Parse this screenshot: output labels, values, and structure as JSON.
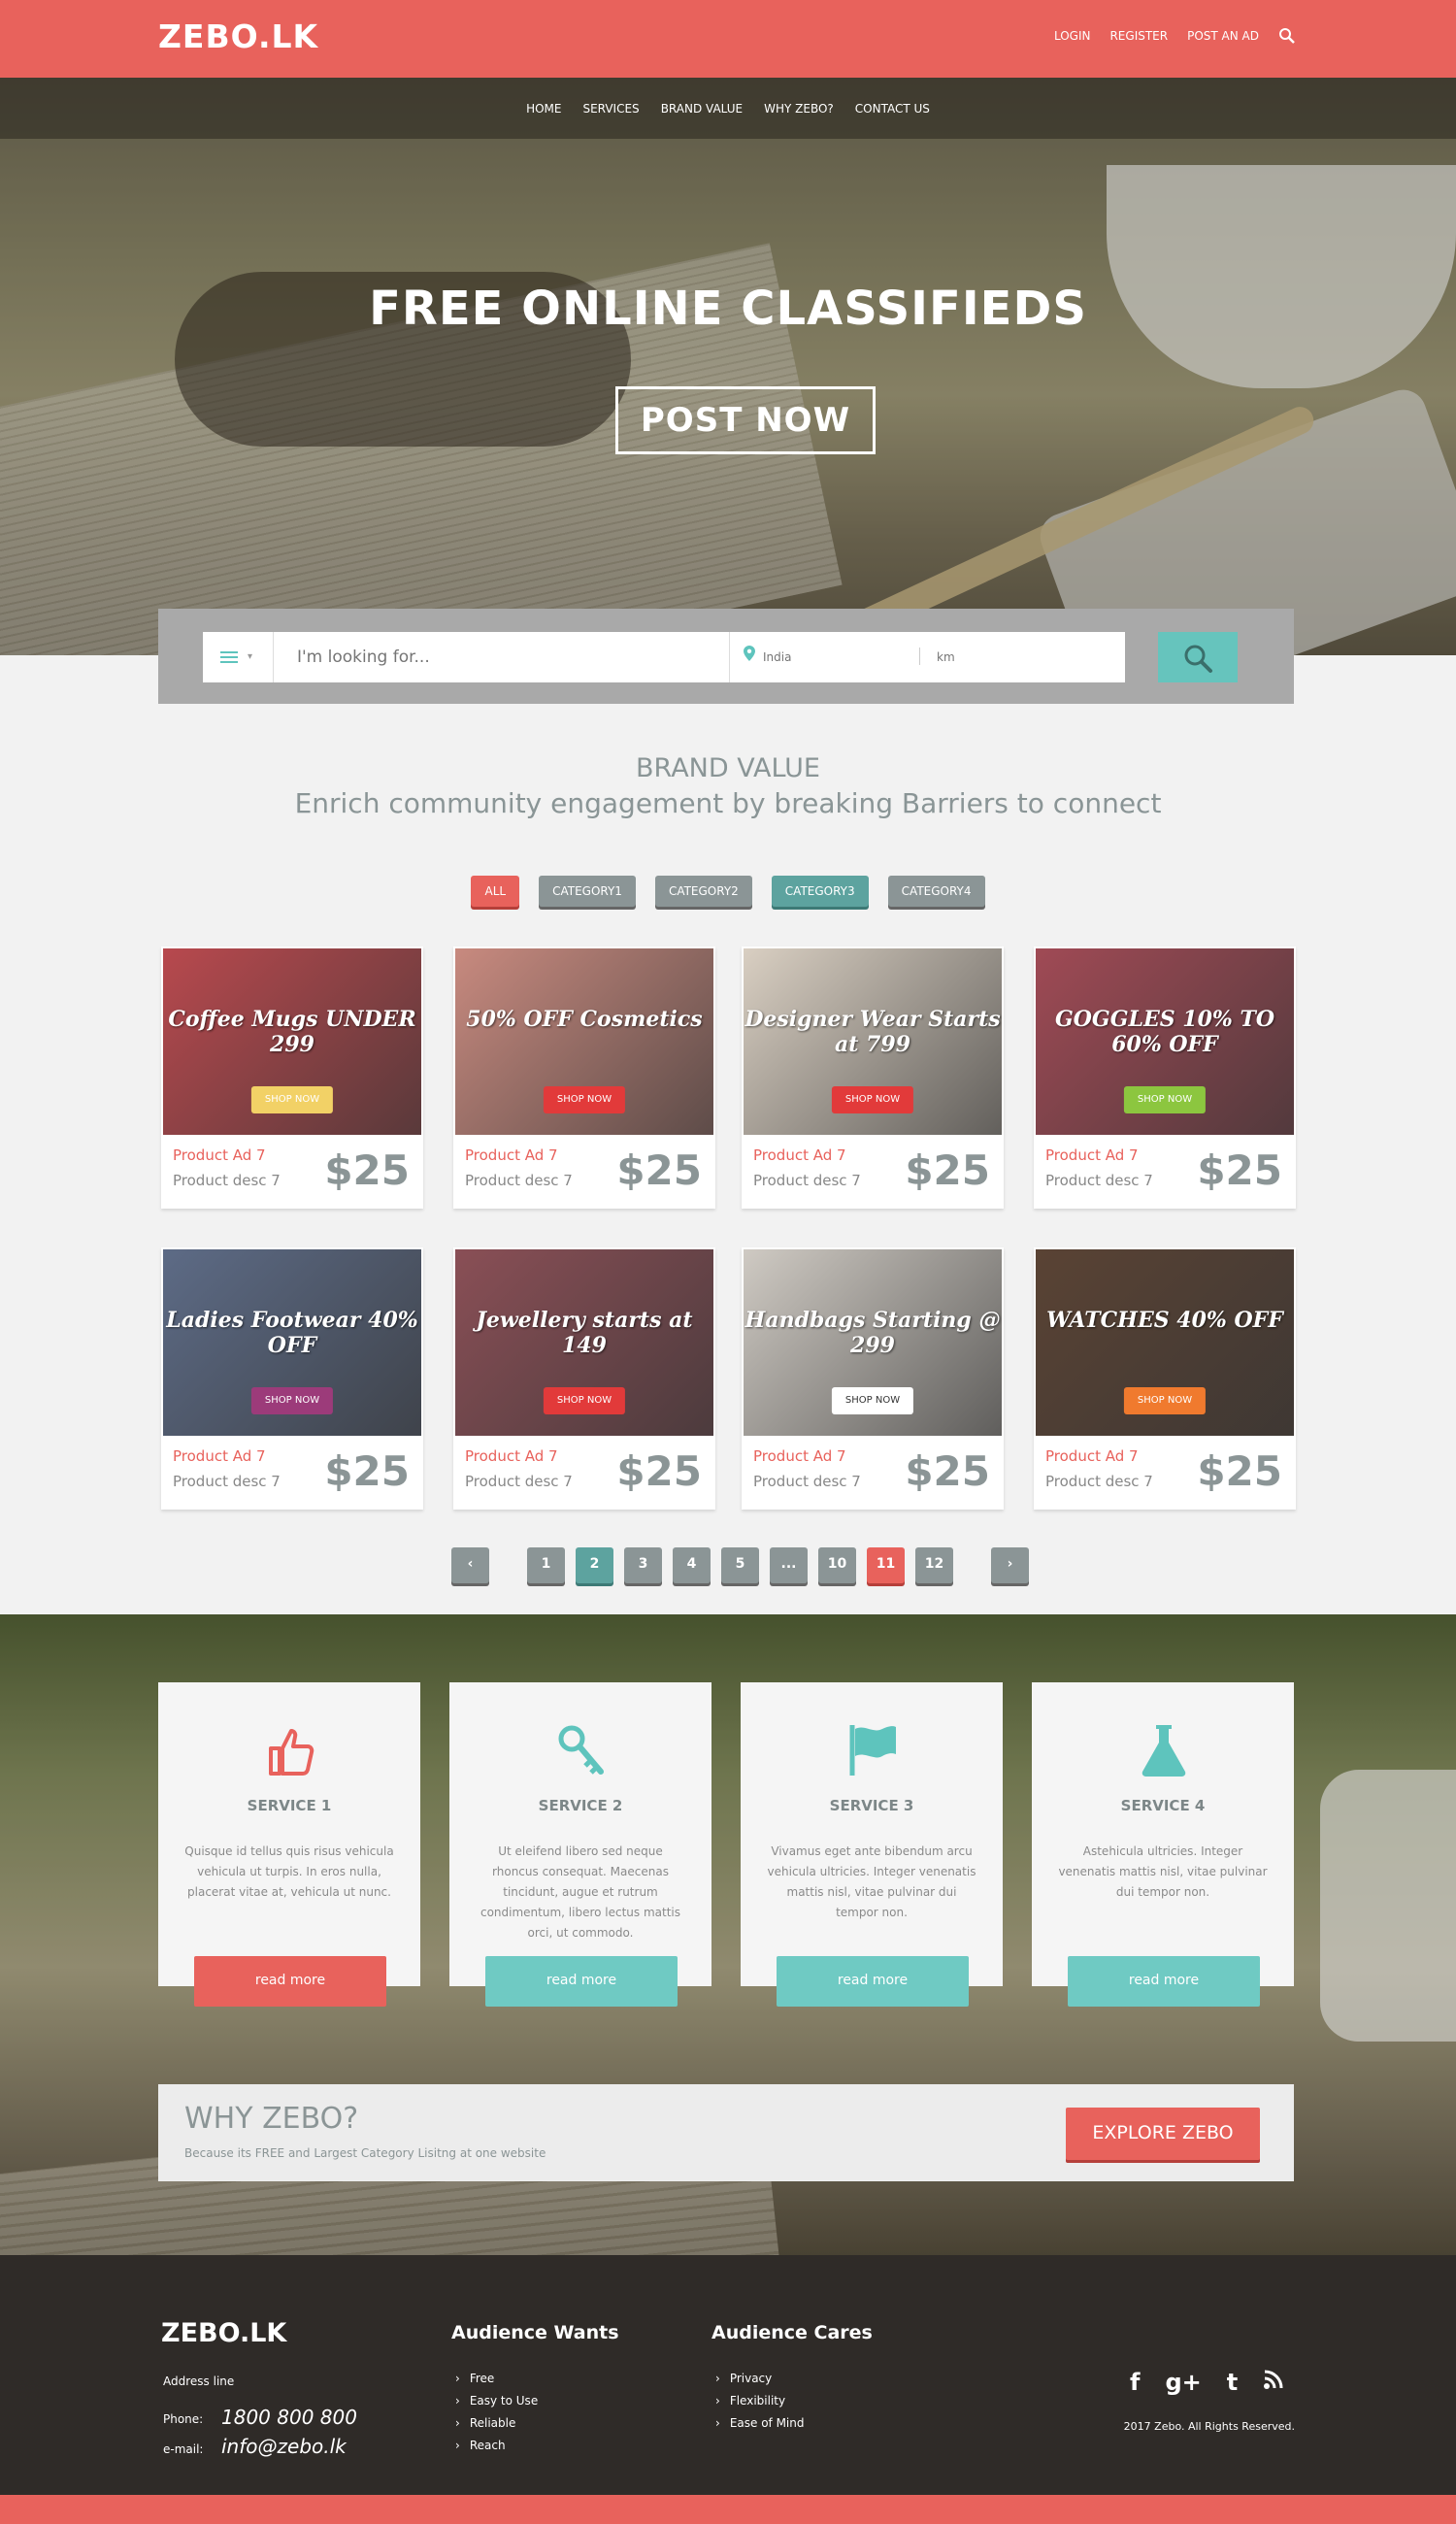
{
  "header": {
    "logo": "ZEBO.LK",
    "links": [
      "LOGIN",
      "REGISTER",
      "POST AN AD"
    ]
  },
  "nav": [
    "HOME",
    "SERVICES",
    "BRAND VALUE",
    "WHY ZEBO?",
    "CONTACT US"
  ],
  "hero": {
    "title": "FREE ONLINE CLASSIFIEDS",
    "button": "POST NOW"
  },
  "search": {
    "placeholder": "I'm looking for...",
    "location_placeholder": "India",
    "km_placeholder": "km"
  },
  "brand": {
    "title": "BRAND VALUE",
    "subtitle": "Enrich community engagement by breaking Barriers to connect"
  },
  "filters": [
    "ALL",
    "CATEGORY1",
    "CATEGORY2",
    "CATEGORY3",
    "CATEGORY4"
  ],
  "products": [
    {
      "banner": "Coffee Mugs UNDER 299",
      "shop": "SHOP NOW",
      "name": "Product Ad 7",
      "desc": "Product desc 7",
      "price": "$25",
      "bg": "#b8494e",
      "shop_color": "#f2d166"
    },
    {
      "banner": "50% OFF Cosmetics",
      "shop": "SHOP NOW",
      "name": "Product Ad 7",
      "desc": "Product desc 7",
      "price": "$25",
      "bg": "#c88a7f",
      "shop_color": "#e23a3a"
    },
    {
      "banner": "Designer Wear Starts at 799",
      "shop": "SHOP NOW",
      "name": "Product Ad 7",
      "desc": "Product desc 7",
      "price": "$25",
      "bg": "#d9cfc2",
      "shop_color": "#e23a3a"
    },
    {
      "banner": "GOGGLES 10% TO 60% OFF",
      "shop": "SHOP NOW",
      "name": "Product Ad 7",
      "desc": "Product desc 7",
      "price": "$25",
      "bg": "#a04a55",
      "shop_color": "#8cc63f"
    },
    {
      "banner": "Ladies Footwear 40% OFF",
      "shop": "SHOP NOW",
      "name": "Product Ad 7",
      "desc": "Product desc 7",
      "price": "$25",
      "bg": "#5d6b86",
      "shop_color": "#9c3b7a"
    },
    {
      "banner": "Jewellery starts at 149",
      "shop": "SHOP NOW",
      "name": "Product Ad 7",
      "desc": "Product desc 7",
      "price": "$25",
      "bg": "#8a4f56",
      "shop_color": "#e23a3a"
    },
    {
      "banner": "Handbags Starting @ 299",
      "shop": "SHOP NOW",
      "name": "Product Ad 7",
      "desc": "Product desc 7",
      "price": "$25",
      "bg": "#cfcac3",
      "shop_color": "#ffffff"
    },
    {
      "banner": "WATCHES 40% OFF",
      "shop": "SHOP NOW",
      "name": "Product Ad 7",
      "desc": "Product desc 7",
      "price": "$25",
      "bg": "#5a4334",
      "shop_color": "#f07a2e"
    }
  ],
  "pagination": [
    "1",
    "2",
    "3",
    "4",
    "5",
    "...",
    "10",
    "11",
    "12"
  ],
  "services": [
    {
      "title": "SERVICE 1",
      "text": "Quisque id tellus quis risus vehicula vehicula ut turpis. In eros nulla, placerat vitae at, vehicula ut nunc.",
      "button": "read more",
      "icon": "thumbs-up-icon",
      "icon_color": "#e8625c",
      "button_color": "#e8625c"
    },
    {
      "title": "SERVICE 2",
      "text": "Ut eleifend libero sed neque rhoncus consequat. Maecenas tincidunt, augue et rutrum condimentum, libero lectus mattis orci, ut commodo.",
      "button": "read more",
      "icon": "key-icon",
      "icon_color": "#5ec4bd",
      "button_color": "#6fcac3"
    },
    {
      "title": "SERVICE 3",
      "text": "Vivamus eget ante bibendum arcu vehicula ultricies. Integer venenatis mattis nisl, vitae pulvinar dui tempor non.",
      "button": "read more",
      "icon": "flag-icon",
      "icon_color": "#5ec4bd",
      "button_color": "#6fcac3"
    },
    {
      "title": "SERVICE 4",
      "text": "Astehicula ultricies. Integer venenatis mattis nisl, vitae pulvinar dui tempor non.",
      "button": "read more",
      "icon": "flask-icon",
      "icon_color": "#5ec4bd",
      "button_color": "#6fcac3"
    }
  ],
  "why": {
    "title": "WHY ZEBO?",
    "subtitle": "Because its FREE and Largest Category Lisitng at one website",
    "button": "EXPLORE ZEBO"
  },
  "footer": {
    "logo": "ZEBO.LK",
    "address": "Address line",
    "phone_label": "Phone:",
    "phone": "1800 800 800",
    "email_label": "e-mail:",
    "email": "info@zebo.lk",
    "col1_title": "Audience Wants",
    "col1_items": [
      "Free",
      "Easy to Use",
      "Reliable",
      "Reach"
    ],
    "col2_title": "Audience Cares",
    "col2_items": [
      "Privacy",
      "Flexibility",
      "Ease of Mind"
    ],
    "social": [
      "f",
      "g+",
      "t",
      "rss"
    ],
    "copyright": "2017 Zebo. All Rights Reserved."
  },
  "colors": {
    "accent": "#e8625c",
    "teal": "#5ec4bd",
    "slate": "#8b9596"
  }
}
